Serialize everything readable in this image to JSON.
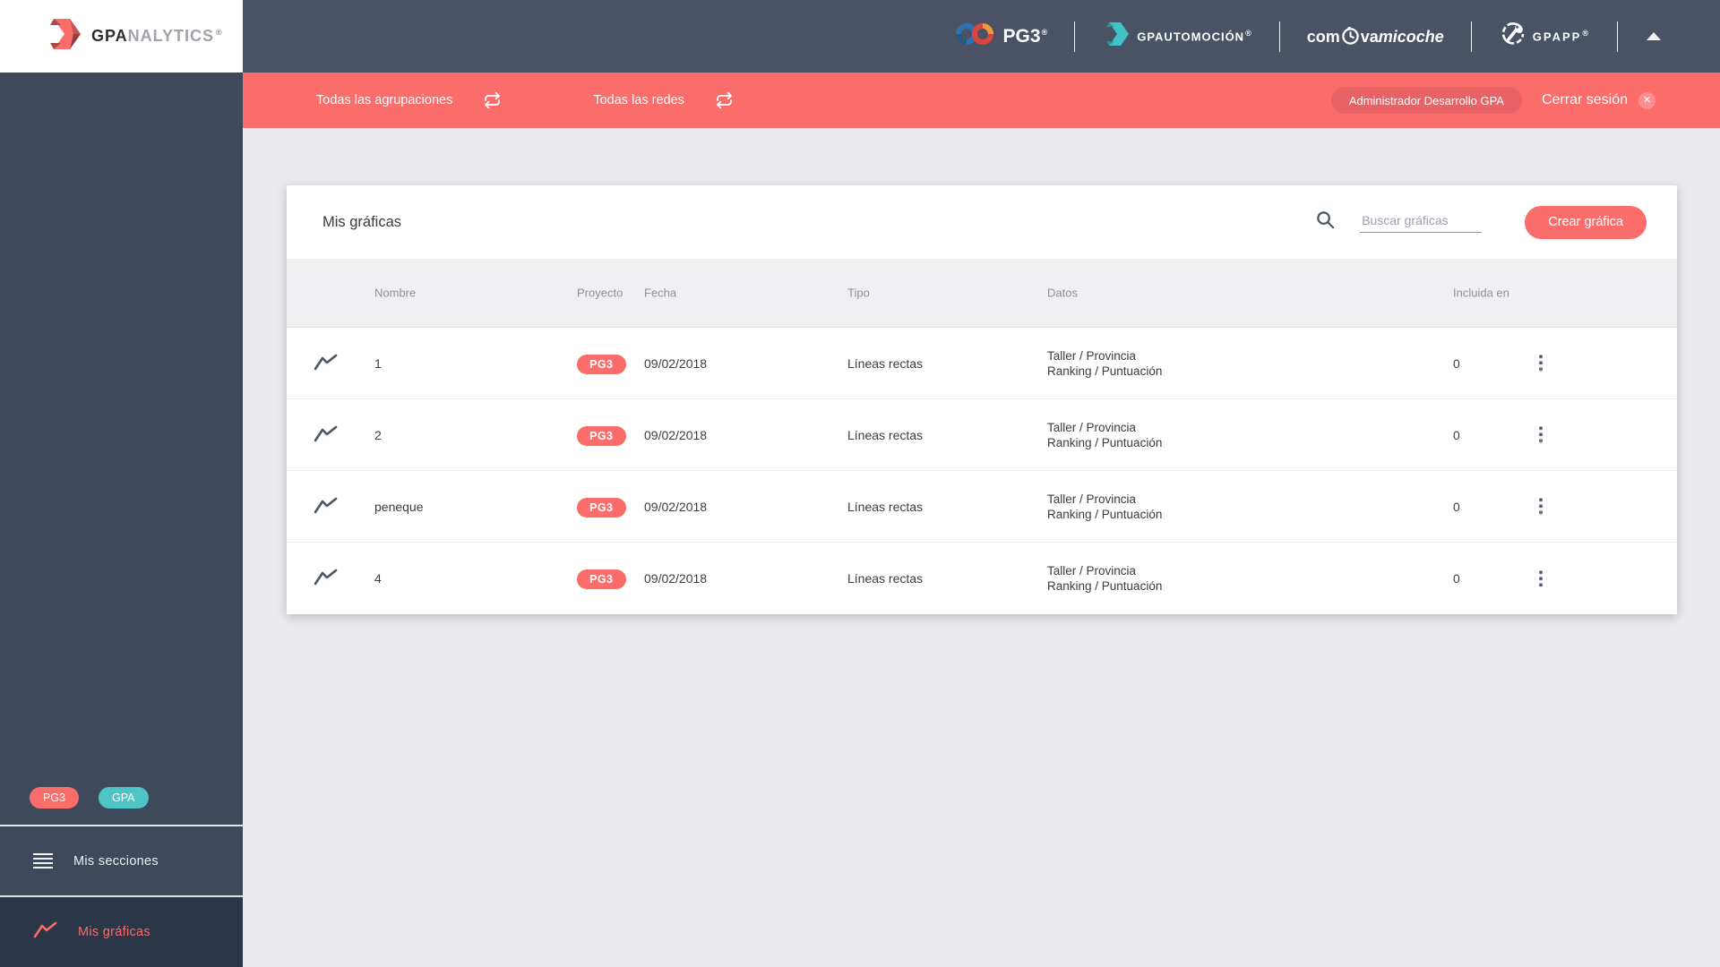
{
  "colors": {
    "accent": "#FA6D6A",
    "teal": "#4FC4C6",
    "header_bg": "#4A5365",
    "sidebar_bg": "#3E4A5C",
    "active_item_bg": "#2B3648"
  },
  "sidebar": {
    "logo": {
      "part1": "GPA",
      "part2": "NALYTICS",
      "reg": "®"
    },
    "badges": [
      {
        "label": "PG3"
      },
      {
        "label": "GPA"
      }
    ],
    "items": [
      {
        "label": "Mis secciones"
      },
      {
        "label": "Mis gráficas"
      }
    ]
  },
  "header": {
    "pg3": "PG3",
    "pg3_reg": "®",
    "gpauto": "GPAUTOMOCIÓN",
    "gpauto_reg": "®",
    "com": "com",
    "va": "va",
    "micoche": "micoche",
    "gpapp": "GPAPP",
    "gpapp_reg": "®"
  },
  "filterbar": {
    "groupings": "Todas las agrupaciones",
    "networks": "Todas las redes",
    "user": "Administrador Desarrollo GPA",
    "logout": "Cerrar sesión",
    "logout_x": "✕"
  },
  "card": {
    "title": "Mis gráficas",
    "search_placeholder": "Buscar gráficas",
    "create_button": "Crear gráfica",
    "table": {
      "columns": [
        "Nombre",
        "Proyecto",
        "Fecha",
        "Tipo",
        "Datos",
        "Incluida en"
      ],
      "rows": [
        {
          "name": "1",
          "project": "PG3",
          "date": "09/02/2018",
          "type": "Líneas rectas",
          "data1": "Taller / Provincia",
          "data2": "Ranking / Puntuación",
          "included": "0"
        },
        {
          "name": "2",
          "project": "PG3",
          "date": "09/02/2018",
          "type": "Líneas rectas",
          "data1": "Taller / Provincia",
          "data2": "Ranking / Puntuación",
          "included": "0"
        },
        {
          "name": "peneque",
          "project": "PG3",
          "date": "09/02/2018",
          "type": "Líneas rectas",
          "data1": "Taller / Provincia",
          "data2": "Ranking / Puntuación",
          "included": "0"
        },
        {
          "name": "4",
          "project": "PG3",
          "date": "09/02/2018",
          "type": "Líneas rectas",
          "data1": "Taller / Provincia",
          "data2": "Ranking / Puntuación",
          "included": "0"
        }
      ]
    }
  }
}
